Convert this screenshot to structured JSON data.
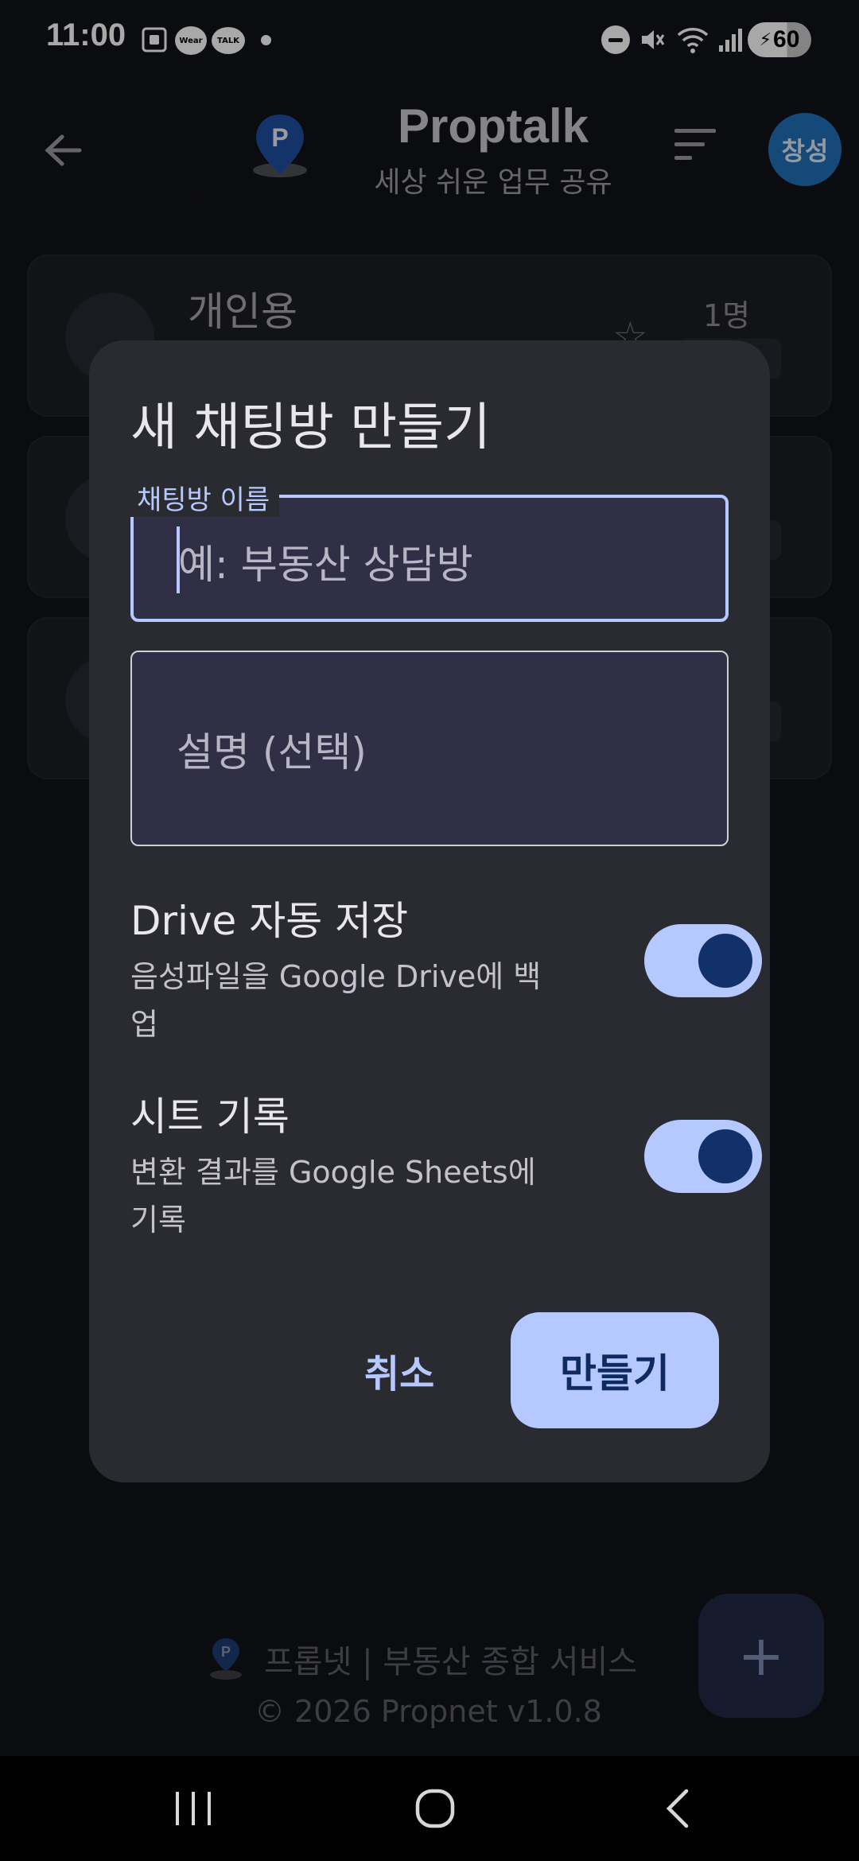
{
  "status_bar": {
    "time": "11:00",
    "wear_label": "Wear",
    "talk_label": "TALK",
    "battery": "60",
    "icons": [
      "screenshot-icon",
      "wear-icon",
      "kakaotalk-icon",
      "dnd-icon",
      "mute-icon",
      "wifi-icon",
      "signal-icon",
      "battery-icon"
    ]
  },
  "header": {
    "title": "Proptalk",
    "subtitle": "세상 쉬운 업무 공유",
    "avatar_label": "창성"
  },
  "rooms": [
    {
      "name": "개인용",
      "count": "1명"
    },
    {
      "name": "",
      "count": ""
    },
    {
      "name": "",
      "count": ""
    }
  ],
  "footer": {
    "brand": "프롭넷 | 부동산 종합 서비스",
    "copyright": "© 2026 Propnet  v1.0.8",
    "fab_label": "+"
  },
  "dialog": {
    "title": "새 채팅방 만들기",
    "name_field": {
      "label": "채팅방 이름",
      "placeholder": "예: 부동산 상담방",
      "value": ""
    },
    "desc_field": {
      "placeholder": "설명 (선택)",
      "value": ""
    },
    "settings": [
      {
        "title": "Drive 자동 저장",
        "description": "음성파일을 Google Drive에 백업",
        "enabled": true
      },
      {
        "title": "시트 기록",
        "description": "변환 결과를 Google Sheets에 기록",
        "enabled": true
      }
    ],
    "cancel_label": "취소",
    "create_label": "만들기"
  },
  "colors": {
    "accent": "#b5c8ff",
    "surface": "#2a2b31",
    "background": "#121318",
    "avatar": "#1f6fb8"
  }
}
